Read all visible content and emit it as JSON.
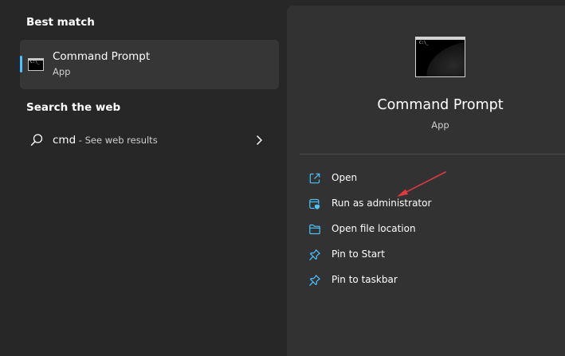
{
  "left": {
    "best_match_heading": "Best match",
    "best_match": {
      "icon": "command-prompt-icon",
      "title": "Command Prompt",
      "subtitle": "App"
    },
    "search_web_heading": "Search the web",
    "web_result": {
      "icon": "search-icon",
      "query": "cmd",
      "suffix": " - See web results",
      "chevron": "chevron-right-icon"
    }
  },
  "detail": {
    "icon": "command-prompt-icon",
    "title": "Command Prompt",
    "subtitle": "App",
    "actions": [
      {
        "label": "Open",
        "icon": "open-external-icon"
      },
      {
        "label": "Run as administrator",
        "icon": "shield-admin-icon"
      },
      {
        "label": "Open file location",
        "icon": "folder-icon"
      },
      {
        "label": "Pin to Start",
        "icon": "pin-icon"
      },
      {
        "label": "Pin to taskbar",
        "icon": "pin-icon"
      }
    ]
  },
  "colors": {
    "background": "#272727",
    "panel": "#323232",
    "selected": "#363636",
    "accent": "#4cc2ff",
    "annotation": "#e0393e"
  }
}
